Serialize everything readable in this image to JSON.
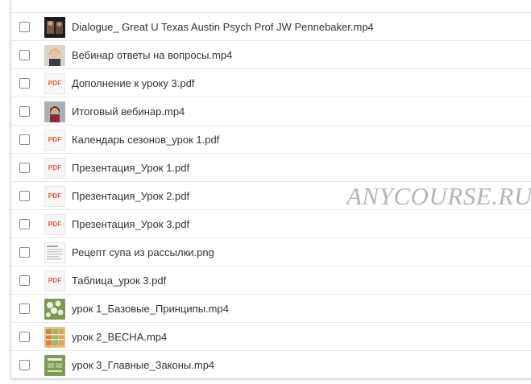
{
  "files": [
    {
      "name": "Dialogue_ Great U Texas Austin Psych Prof JW Pennebaker.mp4",
      "icon": "video-thumbnail-icon"
    },
    {
      "name": "Вебинар ответы на вопросы.mp4",
      "icon": "video-thumbnail-icon"
    },
    {
      "name": "Дополнение к уроку 3.pdf",
      "icon": "pdf-icon",
      "badge": "PDF"
    },
    {
      "name": "Итоговый вебинар.mp4",
      "icon": "video-thumbnail-icon"
    },
    {
      "name": "Календарь сезонов_урок 1.pdf",
      "icon": "pdf-icon",
      "badge": "PDF"
    },
    {
      "name": "Презентация_Урок 1.pdf",
      "icon": "pdf-icon",
      "badge": "PDF"
    },
    {
      "name": "Презентация_Урок 2.pdf",
      "icon": "pdf-icon",
      "badge": "PDF"
    },
    {
      "name": "Презентация_Урок 3.pdf",
      "icon": "pdf-icon",
      "badge": "PDF"
    },
    {
      "name": "Рецепт супа из рассылки.png",
      "icon": "image-thumbnail-icon"
    },
    {
      "name": "Таблица_урок 3.pdf",
      "icon": "pdf-icon",
      "badge": "PDF"
    },
    {
      "name": "урок 1_Базовые_Принципы.mp4",
      "icon": "video-thumbnail-icon"
    },
    {
      "name": "урок 2_ВЕСНА.mp4",
      "icon": "video-thumbnail-icon"
    },
    {
      "name": "урок 3_Главные_Законы.mp4",
      "icon": "video-thumbnail-icon"
    }
  ],
  "watermark": "ANYCOURSE.RU",
  "colors": {
    "pdf_badge": "#e2533f",
    "text": "#333333",
    "divider": "#e8e8e8"
  }
}
